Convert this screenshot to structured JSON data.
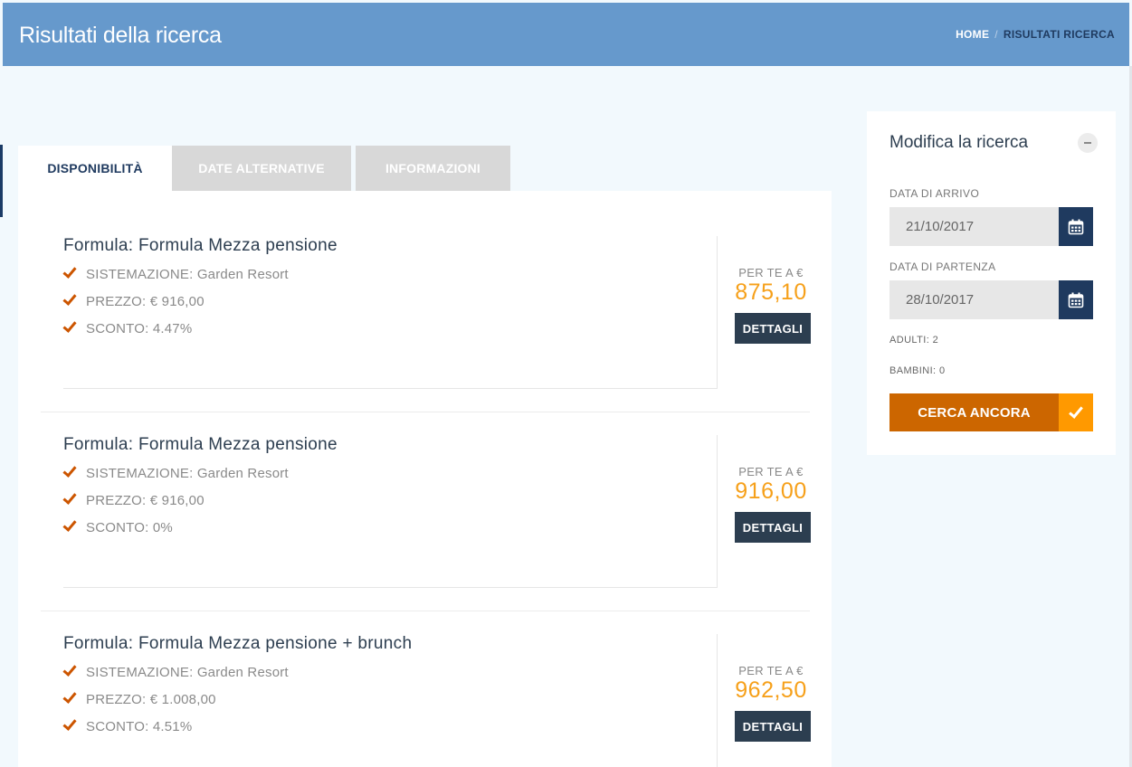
{
  "header": {
    "title": "Risultati della ricerca",
    "breadcrumb": {
      "home": "HOME",
      "separator": "/",
      "current": "RISULTATI RICERCA"
    }
  },
  "tabs": [
    {
      "label": "DISPONIBILITÀ",
      "active": true
    },
    {
      "label": "DATE ALTERNATIVE",
      "active": false
    },
    {
      "label": "INFORMAZIONI",
      "active": false
    }
  ],
  "results": [
    {
      "title": "Formula: Formula Mezza pensione",
      "sistemazione": "SISTEMAZIONE: Garden Resort",
      "prezzo": "PREZZO: € 916,00",
      "sconto": "SCONTO: 4.47%",
      "price_label": "PER TE A €",
      "price": "875,10",
      "button_label": "DETTAGLI"
    },
    {
      "title": "Formula: Formula Mezza pensione",
      "sistemazione": "SISTEMAZIONE: Garden Resort",
      "prezzo": "PREZZO: € 916,00",
      "sconto": "SCONTO: 0%",
      "price_label": "PER TE A €",
      "price": "916,00",
      "button_label": "DETTAGLI"
    },
    {
      "title": "Formula: Formula Mezza pensione + brunch",
      "sistemazione": "SISTEMAZIONE: Garden Resort",
      "prezzo": "PREZZO: € 1.008,00",
      "sconto": "SCONTO: 4.51%",
      "price_label": "PER TE A €",
      "price": "962,50",
      "button_label": "DETTAGLI"
    }
  ],
  "sidebar": {
    "title": "Modifica la ricerca",
    "arrival_label": "DATA DI ARRIVO",
    "arrival_value": "21/10/2017",
    "departure_label": "DATA DI PARTENZA",
    "departure_value": "28/10/2017",
    "adults": "ADULTI: 2",
    "children": "BAMBINI: 0",
    "search_button": "CERCA ANCORA"
  },
  "colors": {
    "header": "#6699cc",
    "accent_orange": "#cc6600",
    "price_orange": "#f6a01a",
    "dark_navy": "#2c3e50"
  },
  "icons": [
    "check-icon",
    "calendar-icon",
    "minus-icon"
  ]
}
